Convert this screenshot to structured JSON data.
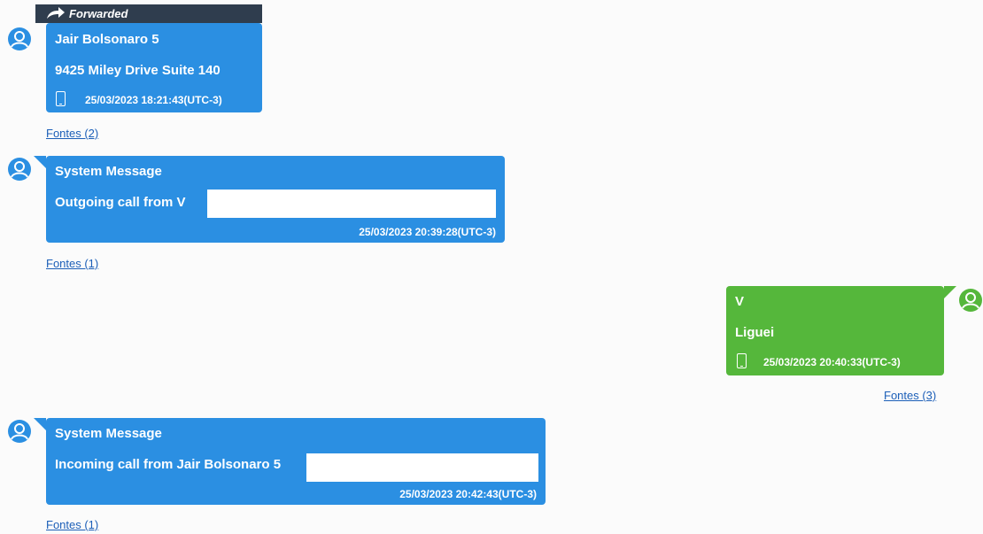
{
  "messages": [
    {
      "forwarded_label": "Forwarded",
      "sender": "Jair Bolsonaro 5",
      "body": "9425 Miley Drive Suite 140",
      "timestamp": "25/03/2023 18:21:43(UTC-3)",
      "sources_link": "Fontes (2)",
      "direction": "incoming",
      "has_device_icon": true
    },
    {
      "sender": "System Message",
      "body": "Outgoing call from V",
      "timestamp": "25/03/2023 20:39:28(UTC-3)",
      "sources_link": "Fontes (1)",
      "direction": "incoming",
      "has_device_icon": false
    },
    {
      "sender": "V",
      "body": "Liguei",
      "timestamp": "25/03/2023 20:40:33(UTC-3)",
      "sources_link": "Fontes (3)",
      "direction": "outgoing",
      "has_device_icon": true
    },
    {
      "sender": "System Message",
      "body": "Incoming call from Jair Bolsonaro 5",
      "timestamp": "25/03/2023 20:42:43(UTC-3)",
      "sources_link": "Fontes (1)",
      "direction": "incoming",
      "has_device_icon": false
    }
  ],
  "icons": {
    "avatar": "user-avatar-icon",
    "forwarded": "forward-arrow-icon",
    "device": "mobile-phone-icon"
  },
  "colors": {
    "incoming_bubble": "#2b8fe2",
    "outgoing_bubble": "#55b73b",
    "forwarded_banner": "#2f3d4e",
    "link": "#1c5fb8"
  }
}
